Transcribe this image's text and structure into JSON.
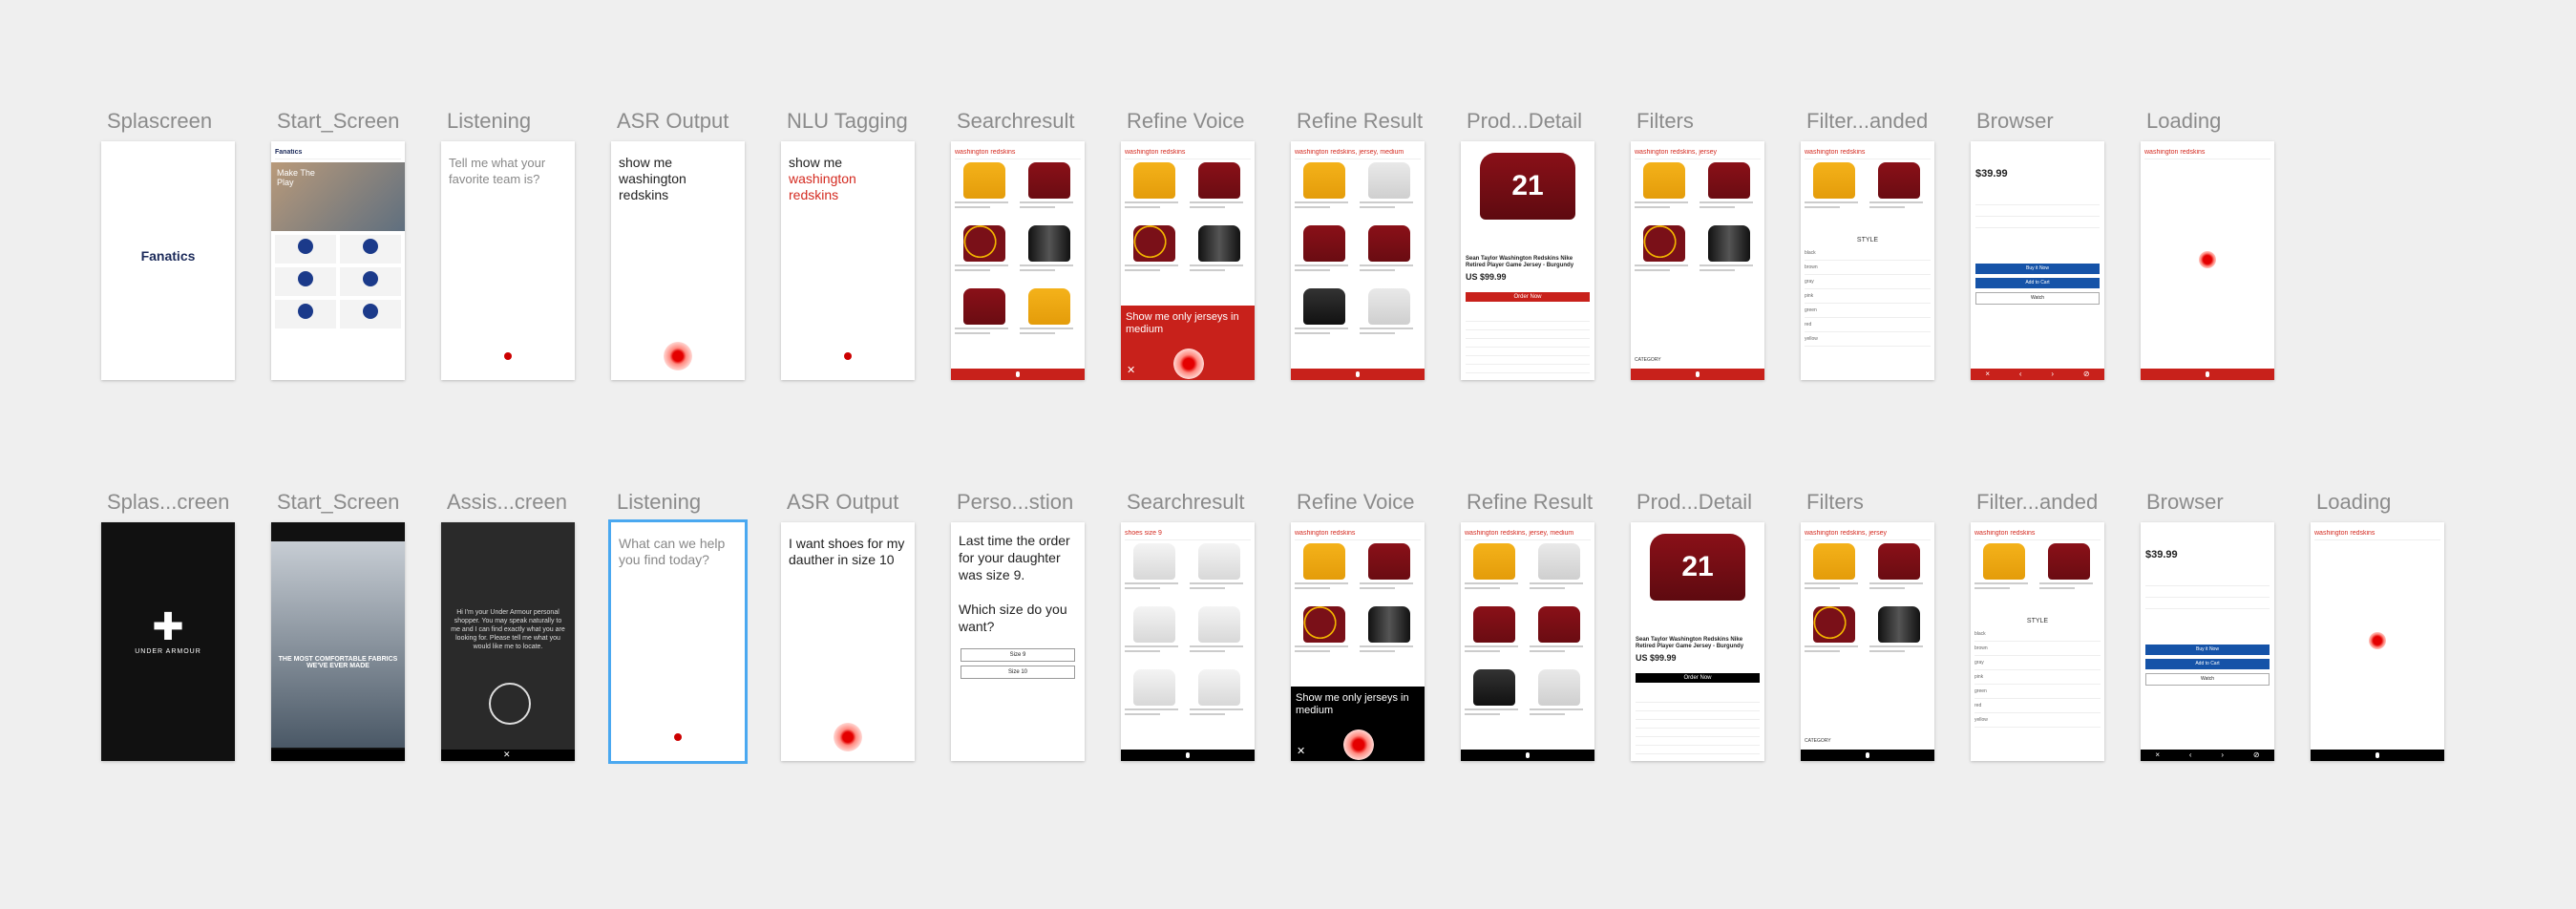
{
  "canvas_background": "#efefef",
  "accent_red": "#c8211b",
  "selection_blue": "#4aa8f0",
  "rows": [
    {
      "artboards": [
        {
          "label": "Splascreen",
          "type": "splash-fanatics",
          "brand": "Fanatics"
        },
        {
          "label": "Start_Screen",
          "type": "start-fanatics",
          "brand": "Fanatics",
          "hero": "Make The Play"
        },
        {
          "label": "Listening",
          "type": "listening",
          "text": "Tell me what your favorite team is?"
        },
        {
          "label": "ASR Output",
          "type": "asr",
          "text": "show me washington redskins"
        },
        {
          "label": "NLU Tagging",
          "type": "nlu",
          "text_plain": "show me",
          "text_tagged": "washington redskins"
        },
        {
          "label": "Searchresult",
          "type": "search",
          "query": "washington redskins"
        },
        {
          "label": "Refine Voice",
          "type": "refine-voice",
          "query": "washington redskins",
          "voice_text": "Show me only jerseys in medium"
        },
        {
          "label": "Refine Result",
          "type": "refine-result",
          "query": "washington redskins, jersey, medium"
        },
        {
          "label": "Prod...Detail",
          "type": "detail",
          "jersey_number": "21",
          "title": "Sean Taylor Washington Redskins Nike Retired Player Game Jersey - Burgundy",
          "price": "US $99.99",
          "cta": "Order Now"
        },
        {
          "label": "Filters",
          "type": "filters",
          "query": "washington redskins, jersey",
          "category": "CATEGORY"
        },
        {
          "label": "Filter...anded",
          "type": "filter-expanded",
          "query": "washington redskins",
          "style_header": "STYLE",
          "style_options": [
            "black",
            "brown",
            "gray",
            "pink",
            "green",
            "red",
            "yellow"
          ]
        },
        {
          "label": "Browser",
          "type": "browser",
          "price": "$39.99",
          "buttons": [
            "Buy it Now",
            "Add to Cart",
            "Watch"
          ]
        },
        {
          "label": "Loading",
          "type": "loading",
          "query": "washington redskins"
        }
      ]
    },
    {
      "artboards": [
        {
          "label": "Splas...creen",
          "type": "splash-ua",
          "brand": "UNDER ARMOUR"
        },
        {
          "label": "Start_Screen",
          "type": "start-ua",
          "hero": "THE MOST COMFORTABLE FABRICS WE'VE EVER MADE"
        },
        {
          "label": "Assis...creen",
          "type": "assistant",
          "text": "Hi I'm your Under Armour personal shopper. You may speak naturally to me and I can find exactly what you are looking for. Please tell me what you would like me to locate."
        },
        {
          "label": "Listening",
          "type": "listening-selected",
          "text": "What can we help you find today?"
        },
        {
          "label": "ASR Output",
          "type": "asr2",
          "text": "I want shoes for my dauther in size 10"
        },
        {
          "label": "Perso...stion",
          "type": "personal",
          "text": "Last time the order for your daughter was size 9.\n\nWhich size do you want?",
          "options": [
            "Size 9",
            "Size 10"
          ]
        },
        {
          "label": "Searchresult",
          "type": "search-shoes",
          "query": "shoes size 9"
        },
        {
          "label": "Refine Voice",
          "type": "refine-voice-black",
          "query": "washington redskins",
          "voice_text": "Show me only jerseys in medium"
        },
        {
          "label": "Refine Result",
          "type": "refine-result-black",
          "query": "washington redskins, jersey, medium"
        },
        {
          "label": "Prod...Detail",
          "type": "detail-black",
          "jersey_number": "21",
          "title": "Sean Taylor Washington Redskins Nike Retired Player Game Jersey - Burgundy",
          "price": "US $99.99",
          "cta": "Order Now"
        },
        {
          "label": "Filters",
          "type": "filters-black",
          "query": "washington redskins, jersey",
          "category": "CATEGORY"
        },
        {
          "label": "Filter...anded",
          "type": "filter-expanded-black",
          "query": "washington redskins",
          "style_header": "STYLE",
          "style_options": [
            "black",
            "brown",
            "gray",
            "pink",
            "green",
            "red",
            "yellow"
          ]
        },
        {
          "label": "Browser",
          "type": "browser-black",
          "price": "$39.99",
          "buttons": [
            "Buy it Now",
            "Add to Cart",
            "Watch"
          ]
        },
        {
          "label": "Loading",
          "type": "loading-black",
          "query": "washington redskins"
        }
      ]
    }
  ]
}
